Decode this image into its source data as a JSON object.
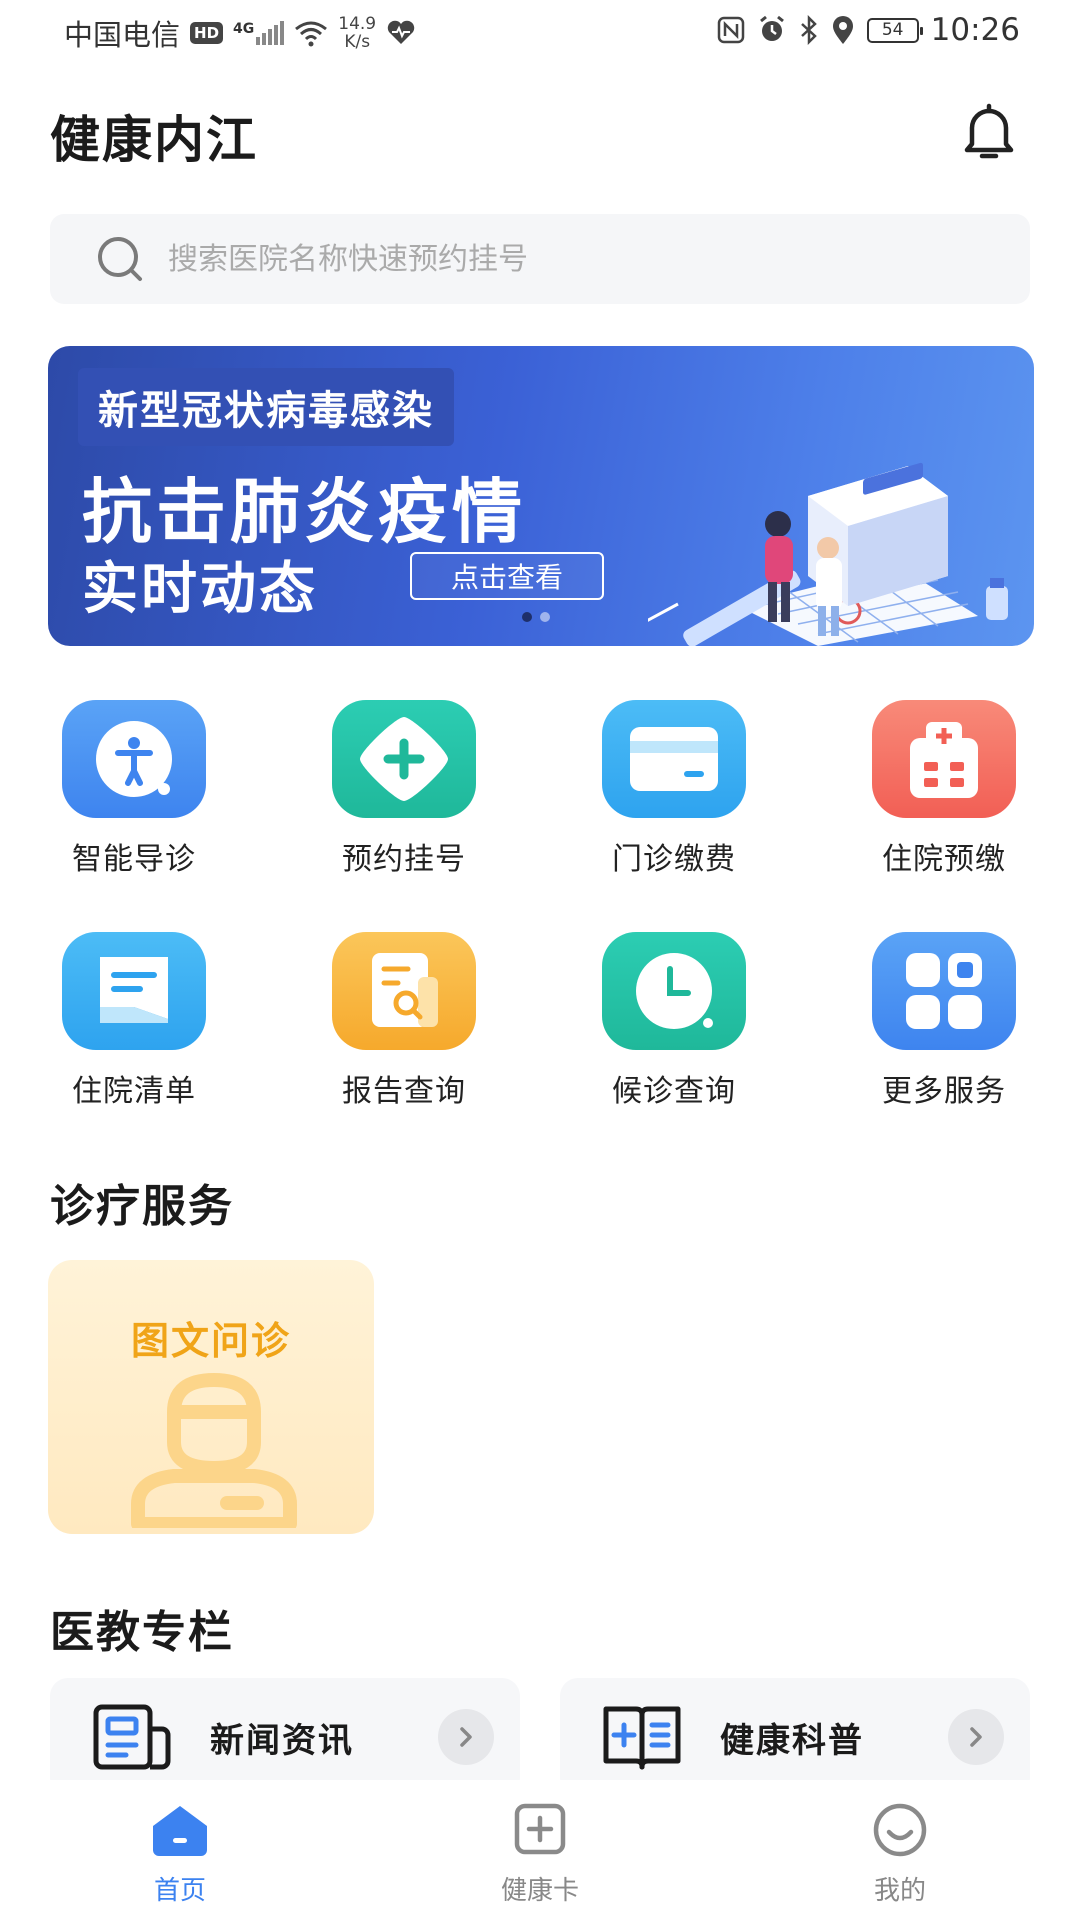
{
  "status_bar": {
    "carrier": "中国电信",
    "hd": "HD",
    "net": "4G",
    "speed_value": "14.9",
    "speed_unit": "K/s",
    "battery": "54",
    "time": "10:26"
  },
  "header": {
    "title": "健康内江"
  },
  "search": {
    "placeholder": "搜索医院名称快速预约挂号"
  },
  "banner": {
    "tag": "新型冠状病毒感染",
    "headline": "抗击肺炎疫情",
    "subhead": "实时动态",
    "cta": "点击查看",
    "page_count": 2,
    "active_index": 0
  },
  "services": [
    {
      "label": "智能导诊",
      "icon": "guide-icon",
      "color": "#4a8ff0"
    },
    {
      "label": "预约挂号",
      "icon": "plus-diamond-icon",
      "color": "#23c2a6"
    },
    {
      "label": "门诊缴费",
      "icon": "card-icon",
      "color": "#3eb1f4"
    },
    {
      "label": "住院预缴",
      "icon": "hospital-icon",
      "color": "#f46e60"
    },
    {
      "label": "住院清单",
      "icon": "list-icon",
      "color": "#3eaff0"
    },
    {
      "label": "报告查询",
      "icon": "report-icon",
      "color": "#f7b53a"
    },
    {
      "label": "候诊查询",
      "icon": "clock-icon",
      "color": "#24c2a3"
    },
    {
      "label": "更多服务",
      "icon": "more-grid-icon",
      "color": "#4a8ff0"
    }
  ],
  "sections": {
    "consult_title": "诊疗服务",
    "consult_card": "图文问诊",
    "edu_title": "医教专栏",
    "edu_items": [
      {
        "label": "新闻资讯",
        "icon": "news-icon"
      },
      {
        "label": "健康科普",
        "icon": "book-icon"
      }
    ]
  },
  "tabs": [
    {
      "label": "首页",
      "icon": "home-icon",
      "active": true
    },
    {
      "label": "健康卡",
      "icon": "health-card-icon",
      "active": false
    },
    {
      "label": "我的",
      "icon": "profile-icon",
      "active": false
    }
  ],
  "colors": {
    "accent": "#3c82f0",
    "banner": "#3b61d6",
    "consult": "#f0a418"
  }
}
